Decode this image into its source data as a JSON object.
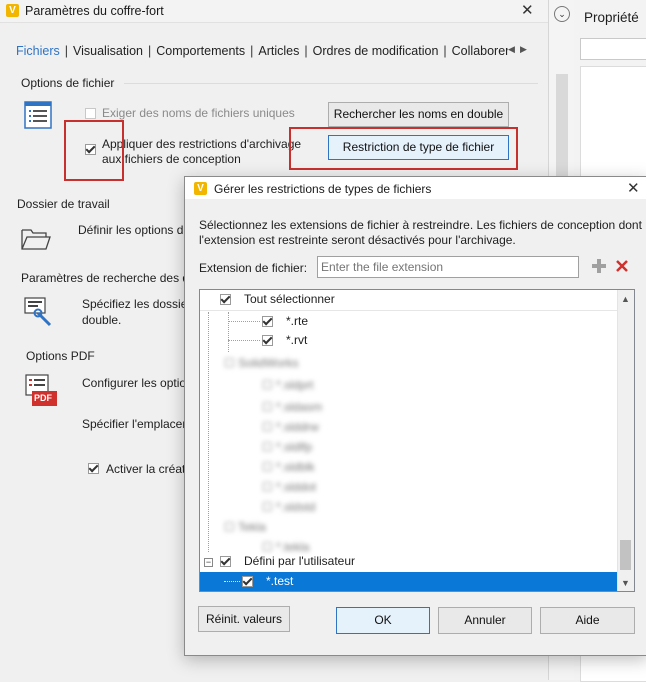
{
  "vault": {
    "title": "Paramètres du coffre-fort",
    "tabs": [
      "Fichiers",
      "Visualisation",
      "Comportements",
      "Articles",
      "Ordres de modification",
      "Collaborer"
    ],
    "file_options": {
      "header": "Options de fichier",
      "unique_names_label": "Exiger des noms de fichiers uniques",
      "find_duplicates_button": "Rechercher les noms en double",
      "restrict_checkin_label_1": "Appliquer des restrictions d'archivage",
      "restrict_checkin_label_2": "aux fichiers de conception",
      "file_type_restriction_button": "Restriction de type de fichier"
    },
    "working_folder": {
      "header": "Dossier de travail",
      "text": "Définir les options d"
    },
    "search_settings": {
      "header": "Paramètres de recherche des d",
      "text_1": "Spécifiez les dossier",
      "text_2": "double."
    },
    "pdf_options": {
      "header": "Options PDF",
      "configure_text": "Configurer les optio",
      "specify_text": "Spécifier l'emplacer",
      "activate_text": "Activer la créat",
      "pdf_label": "PDF"
    }
  },
  "right_panel": {
    "title": "Propriété"
  },
  "dialog": {
    "title": "Gérer les restrictions de types de fichiers",
    "description_1": "Sélectionnez les extensions de fichier à restreindre. Les fichiers de conception dont",
    "description_2": "l'extension est restreinte seront désactivés pour l'archivage.",
    "extension_label": "Extension de fichier:",
    "extension_placeholder": "Enter the file extension",
    "select_all_label": "Tout sélectionner",
    "items": {
      "rte": "*.rte",
      "rvt": "*.rvt",
      "user_defined": "Défini par l'utilisateur",
      "test": "*.test"
    },
    "blurred_items": [
      "SolidWorks",
      "*.sldprt",
      "*.sldasm",
      "*.slddrw",
      "*.sldlfp",
      "*.sldblk",
      "*.slddot",
      "*.sldstd",
      "*.sldftp",
      "Tekla",
      "*.tekla"
    ],
    "buttons": {
      "reset": "Réinit. valeurs",
      "ok": "OK",
      "cancel": "Annuler",
      "help": "Aide"
    }
  },
  "colors": {
    "selection": "#0a78d7",
    "highlight_border": "#c7302d",
    "active_tab": "#2f73c4"
  }
}
